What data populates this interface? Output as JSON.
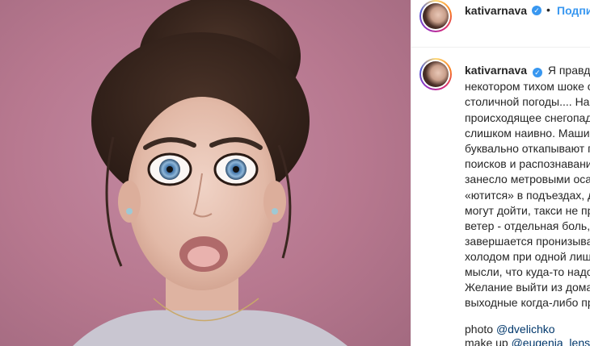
{
  "post": {
    "username": "kativarnava",
    "follow_label": "Подписаться",
    "separator": "•",
    "caption_lines": [
      "Я правда пребываю в",
      "некотором тихом шоке от",
      "столичной погоды.... Наверное,",
      "происходящее снегопадом назвать",
      "слишком наивно. Машины",
      "буквально откапывают после",
      "поисков и распознавания, дороги",
      "занесло метровыми осадками, люди",
      "«ютится» в подъездах, дома не",
      "могут дойти, такси не приезжают,",
      "ветер - отдельная боль, день",
      "завершается пронизывающим",
      "холодом при одной лишь",
      "мысли, что куда-то надо идти.",
      "Желание выйти из дома на",
      "выходные когда-либо пропало."
    ],
    "credits": [
      {
        "prefix": "photo ",
        "handle": "@dvelichko"
      },
      {
        "prefix": "make up ",
        "handle": "@eugenia_lenskaya"
      }
    ]
  },
  "colors": {
    "background": "#b7788f",
    "link": "#00376b",
    "follow": "#3897f0",
    "verified": "#3897f0"
  }
}
